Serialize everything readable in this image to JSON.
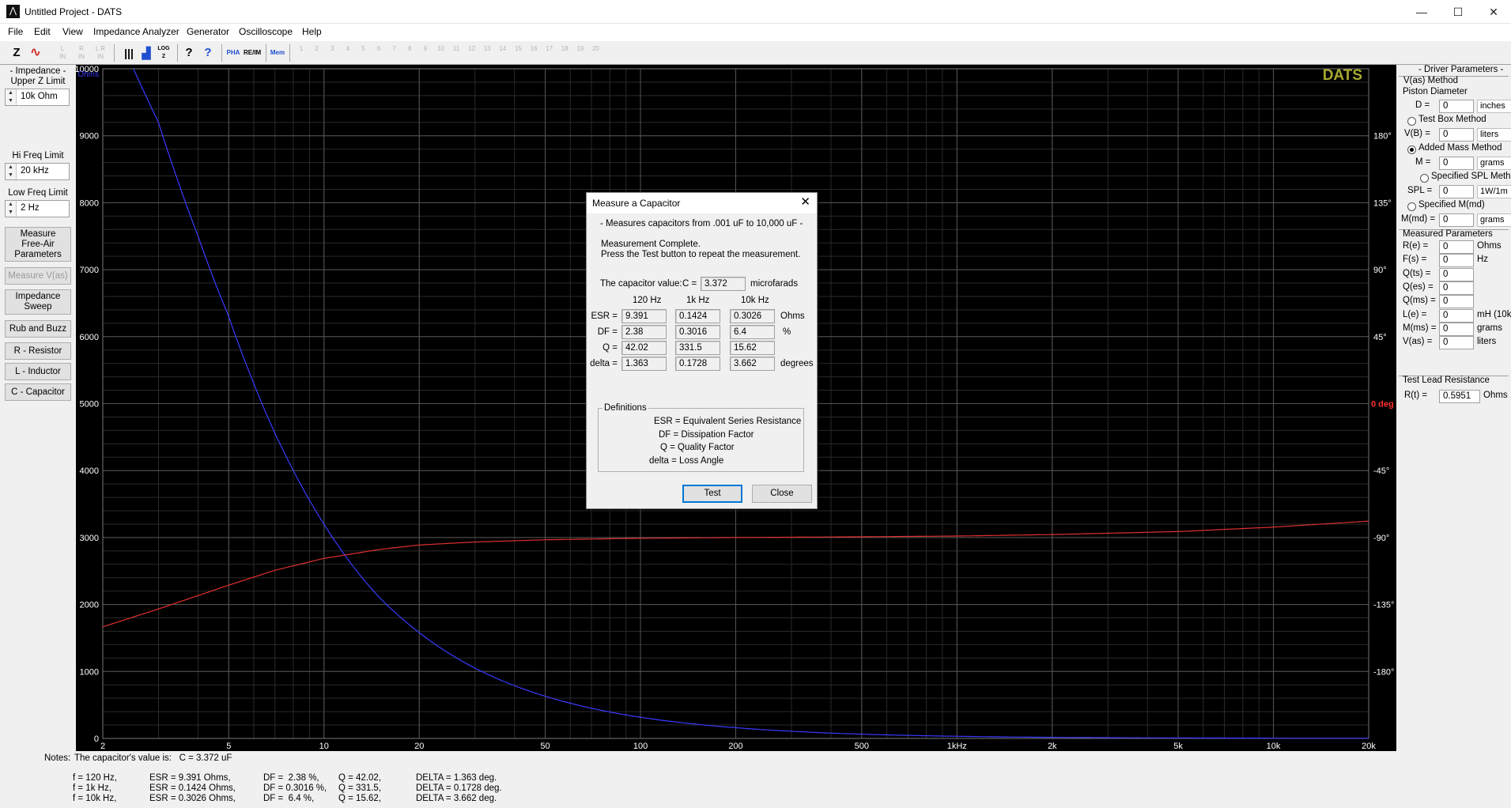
{
  "window": {
    "title": "Untitled Project - DATS",
    "controls": {
      "minimize": "—",
      "maximize": "☐",
      "close": "✕"
    }
  },
  "menu": [
    "File",
    "Edit",
    "View",
    "Impedance Analyzer",
    "Generator",
    "Oscilloscope",
    "Help"
  ],
  "toolbar": {
    "zoom": "Z",
    "phase": "∿",
    "ls1": "L\nIN",
    "r1": "R\nIN",
    "lr": "L R\nIN",
    "bars": "|||",
    "hist": "▟",
    "log": "LOG\nZ",
    "help": "?",
    "help_ctx": "?",
    "pha": "PHA",
    "reim": "RE/IM",
    "mem": "Mem",
    "mem_slots": [
      "1",
      "2",
      "3",
      "4",
      "5",
      "6",
      "7",
      "8",
      "9",
      "10",
      "11",
      "12",
      "13",
      "14",
      "15",
      "16",
      "17",
      "18",
      "19",
      "20"
    ]
  },
  "left_panel": {
    "impedance_title": "- Impedance -",
    "upper_z_label": "Upper Z Limit",
    "upper_z_value": "10k Ohm",
    "hi_freq_label": "Hi Freq Limit",
    "hi_freq_value": "20 kHz",
    "low_freq_label": "Low Freq Limit",
    "low_freq_value": "2 Hz",
    "buttons": [
      "Measure\nFree-Air\nParameters",
      "Measure V(as)",
      "Impedance\nSweep",
      "Rub and Buzz",
      "R - Resistor",
      "L - Inductor",
      "C - Capacitor"
    ]
  },
  "graph": {
    "brand": "DATS",
    "y_unit": "Ohms",
    "phase_zero_label": "0 deg",
    "colors": {
      "impedance": "#3a3aff",
      "phase": "#e03030",
      "grid_major": "#555555",
      "grid_minor": "#2a2a2a",
      "brand": "#a8a830"
    }
  },
  "chart_data": {
    "type": "line",
    "x_scale": "log",
    "xlim": [
      2,
      20000
    ],
    "x_ticks": [
      {
        "v": 2,
        "l": "2"
      },
      {
        "v": 5,
        "l": "5"
      },
      {
        "v": 10,
        "l": "10"
      },
      {
        "v": 20,
        "l": "20"
      },
      {
        "v": 50,
        "l": "50"
      },
      {
        "v": 100,
        "l": "100"
      },
      {
        "v": 200,
        "l": "200"
      },
      {
        "v": 500,
        "l": "500"
      },
      {
        "v": 1000,
        "l": "1kHz"
      },
      {
        "v": 2000,
        "l": "2k"
      },
      {
        "v": 5000,
        "l": "5k"
      },
      {
        "v": 10000,
        "l": "10k"
      },
      {
        "v": 20000,
        "l": "20k"
      }
    ],
    "ylim": [
      0,
      10000
    ],
    "y_ticks": [
      0,
      1000,
      2000,
      3000,
      4000,
      5000,
      6000,
      7000,
      8000,
      9000,
      10000
    ],
    "y2_ticks": [
      {
        "v": 180,
        "l": "180°"
      },
      {
        "v": 135,
        "l": "135°"
      },
      {
        "v": 90,
        "l": "90°"
      },
      {
        "v": 45,
        "l": "45°"
      },
      {
        "v": -45,
        "l": "-45°"
      },
      {
        "v": -90,
        "l": "-90°"
      },
      {
        "v": -135,
        "l": "-135°"
      },
      {
        "v": -180,
        "l": "-180°"
      }
    ],
    "series": [
      {
        "name": "Impedance",
        "axis": "y",
        "x": [
          2.5,
          3,
          4,
          5,
          6,
          8,
          10,
          12,
          15,
          20,
          30,
          50,
          100,
          200,
          500,
          1000,
          2000,
          5000,
          10000,
          20000
        ],
        "values": [
          10000,
          9200,
          7500,
          6300,
          5300,
          4000,
          3200,
          2650,
          2100,
          1580,
          1050,
          630,
          316,
          160,
          64,
          32,
          16,
          7,
          4,
          3
        ]
      },
      {
        "name": "Phase",
        "axis": "y2",
        "x": [
          2,
          3,
          5,
          7,
          10,
          15,
          20,
          30,
          50,
          100,
          200,
          500,
          1000,
          2000,
          5000,
          10000,
          20000
        ],
        "values": [
          -150,
          -138,
          -122,
          -112,
          -104,
          -98,
          -95,
          -93,
          -91.5,
          -90.5,
          -90,
          -89.5,
          -89,
          -88,
          -86,
          -83,
          -79
        ]
      }
    ]
  },
  "right_panel": {
    "title": "- Driver Parameters -",
    "vas_method": "V(as) Method",
    "piston_diameter": "Piston Diameter",
    "d_label": "D =",
    "d_value": "0",
    "d_unit": "inches",
    "test_box": "Test Box Method",
    "vb_label": "V(B) =",
    "vb_value": "0",
    "vb_unit": "liters",
    "added_mass": "Added Mass Method",
    "m_label": "M =",
    "m_value": "0",
    "m_unit": "grams",
    "specified_spl": "Specified SPL Method",
    "spl_label": "SPL =",
    "spl_value": "0",
    "spl_unit": "1W/1m",
    "specified_mmd": "Specified M(md)",
    "mmd_label": "M(md) =",
    "mmd_value": "0",
    "mmd_unit": "grams",
    "measured_title": "Measured Parameters",
    "measured": [
      {
        "label": "R(e) =",
        "value": "0",
        "unit": "Ohms"
      },
      {
        "label": "F(s) =",
        "value": "0",
        "unit": "Hz"
      },
      {
        "label": "Q(ts) =",
        "value": "0",
        "unit": ""
      },
      {
        "label": "Q(es) =",
        "value": "0",
        "unit": ""
      },
      {
        "label": "Q(ms) =",
        "value": "0",
        "unit": ""
      },
      {
        "label": "L(e) =",
        "value": "0",
        "unit": "mH (10k)"
      },
      {
        "label": "M(ms) =",
        "value": "0",
        "unit": "grams"
      },
      {
        "label": "V(as) =",
        "value": "0",
        "unit": "liters"
      }
    ],
    "lead_title": "Test Lead Resistance",
    "rt_label": "R(t) =",
    "rt_value": "0.5951",
    "rt_unit": "Ohms"
  },
  "notes": {
    "label": "Notes:",
    "summary": "The capacitor's value is:   C = 3.372 uF",
    "rows": [
      [
        "f = 120 Hz,",
        "ESR = 9.391 Ohms,",
        "DF =  2.38 %,",
        "Q = 42.02,",
        "DELTA = 1.363 deg."
      ],
      [
        "f = 1k Hz,",
        "ESR = 0.1424 Ohms,",
        "DF = 0.3016 %,",
        "Q = 331.5,",
        "DELTA = 0.1728 deg."
      ],
      [
        "f = 10k Hz,",
        "ESR = 0.3026 Ohms,",
        "DF =  6.4 %,",
        "Q = 15.62,",
        "DELTA = 3.662 deg."
      ]
    ]
  },
  "dialog": {
    "title": "Measure a Capacitor",
    "close_icon": "✕",
    "range_text": "- Measures capacitors from .001 uF to 10,000 uF -",
    "status_line1": "Measurement Complete.",
    "status_line2": "Press the Test button to repeat the measurement.",
    "cap_label": "The capacitor value:",
    "c_eq": "C =",
    "cap_value": "3.372",
    "cap_unit": "microfarads",
    "columns": [
      "120 Hz",
      "1k Hz",
      "10k Hz"
    ],
    "rows": [
      {
        "label": "ESR =",
        "values": [
          "9.391",
          "0.1424",
          "0.3026"
        ],
        "unit": "Ohms"
      },
      {
        "label": "DF =",
        "values": [
          "2.38",
          "0.3016",
          "6.4"
        ],
        "unit": "%"
      },
      {
        "label": "Q =",
        "values": [
          "42.02",
          "331.5",
          "15.62"
        ],
        "unit": ""
      },
      {
        "label": "delta =",
        "values": [
          "1.363",
          "0.1728",
          "3.662"
        ],
        "unit": "degrees"
      }
    ],
    "definitions_title": "Definitions",
    "definitions": [
      "ESR = Equivalent Series Resistance",
      "DF = Dissipation Factor",
      "Q = Quality Factor",
      "delta = Loss Angle"
    ],
    "test_button": "Test",
    "close_button": "Close"
  }
}
